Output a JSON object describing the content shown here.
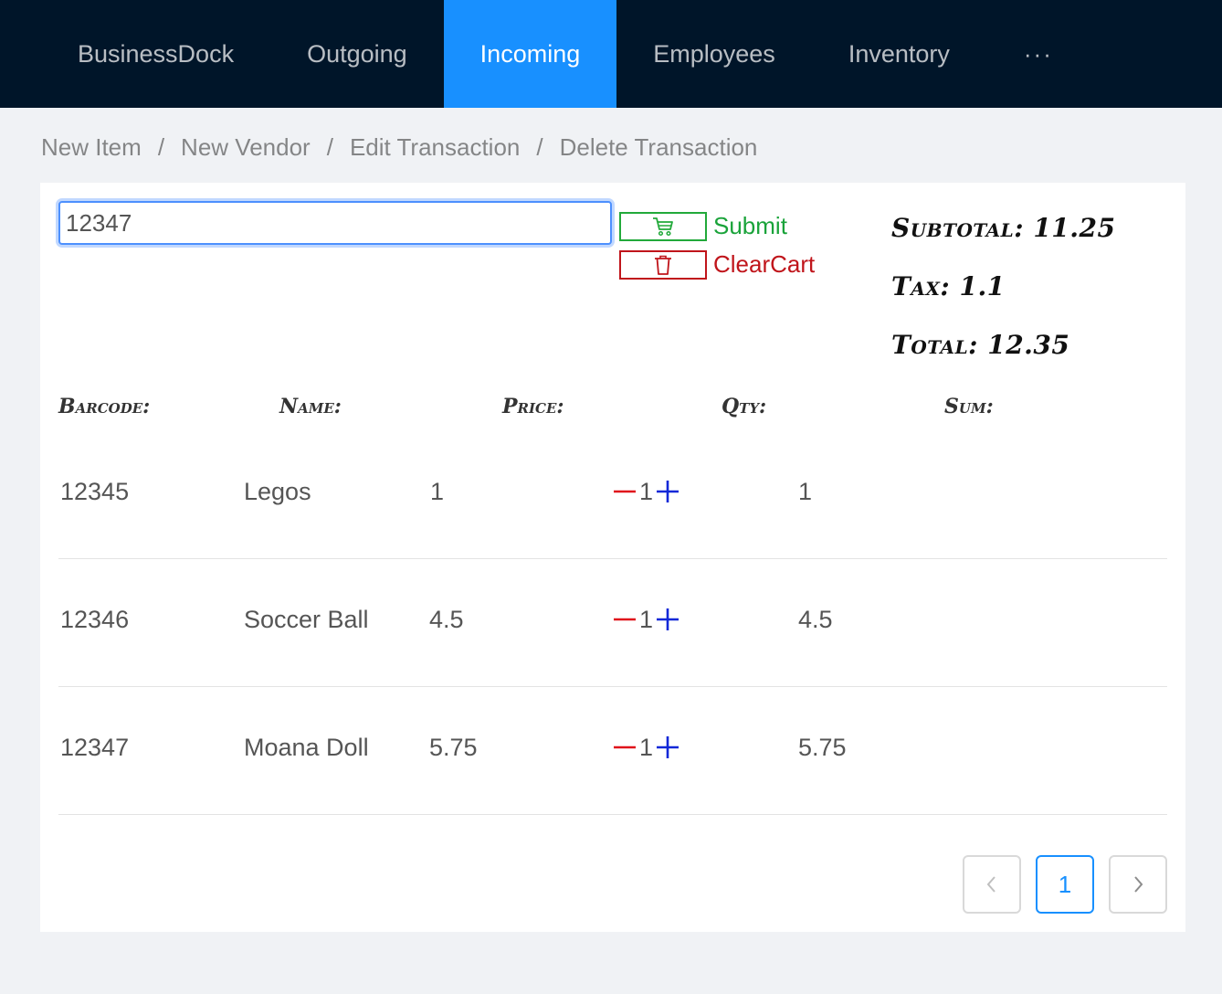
{
  "nav": {
    "items": [
      {
        "label": "BusinessDock"
      },
      {
        "label": "Outgoing"
      },
      {
        "label": "Incoming"
      },
      {
        "label": "Employees"
      },
      {
        "label": "Inventory"
      },
      {
        "label": "···"
      }
    ],
    "active": "Incoming",
    "active_color": "#1890ff",
    "bg_color": "#001529"
  },
  "breadcrumb": {
    "items": [
      "New Item",
      "New Vendor",
      "Edit Transaction",
      "Delete Transaction"
    ],
    "separator": "/"
  },
  "cart": {
    "barcode_value": "12347",
    "submit_label": "Submit",
    "clear_label": "ClearCart",
    "submit_color": "#1aa33a",
    "clear_color": "#c0151b"
  },
  "totals": {
    "subtotal": "Subtotal: 11.25",
    "tax": "Tax: 1.1",
    "total": "Total: 12.35"
  },
  "table": {
    "headers": [
      "Barcode:",
      "Name:",
      "Price:",
      "Qty:",
      "Sum:"
    ],
    "rows": [
      {
        "barcode": "12345",
        "name": "Legos",
        "price": "1",
        "qty": "1",
        "sum": "1"
      },
      {
        "barcode": "12346",
        "name": "Soccer Ball",
        "price": "4.5",
        "qty": "1",
        "sum": "4.5"
      },
      {
        "barcode": "12347",
        "name": "Moana Doll",
        "price": "5.75",
        "qty": "1",
        "sum": "5.75"
      }
    ]
  },
  "pagination": {
    "current_page": "1",
    "prev_icon": "chevron-left-icon",
    "next_icon": "chevron-right-icon"
  }
}
